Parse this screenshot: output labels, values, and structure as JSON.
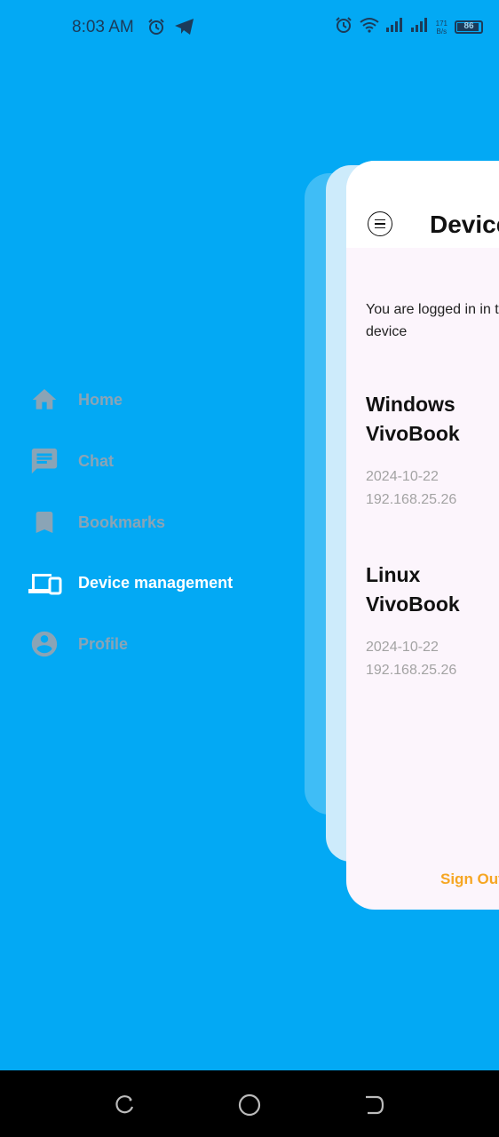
{
  "status_bar": {
    "time": "8:03 AM",
    "net_speed_value": "171",
    "net_speed_unit": "B/s",
    "battery_level": "86",
    "left_icons": [
      "alarm-icon",
      "telegram-icon"
    ],
    "right_icons": [
      "alarm-icon",
      "wifi-icon",
      "signal-icon",
      "signal-icon",
      "battery-icon"
    ]
  },
  "drawer": {
    "items": [
      {
        "label": "Home",
        "icon": "home-icon"
      },
      {
        "label": "Chat",
        "icon": "chat-icon"
      },
      {
        "label": "Bookmarks",
        "icon": "bookmark-icon"
      },
      {
        "label": "Device management",
        "icon": "devices-icon",
        "active": true
      },
      {
        "label": "Profile",
        "icon": "profile-icon"
      }
    ]
  },
  "screen": {
    "title": "Device",
    "intro": "You are logged in in these device",
    "devices": [
      {
        "name": "Windows VivoBook",
        "date": "2024-10-22",
        "ip": "192.168.25.26"
      },
      {
        "name": "Linux VivoBook",
        "date": "2024-10-22",
        "ip": "192.168.25.26"
      }
    ],
    "sign_out": "Sign Out"
  },
  "colors": {
    "background": "#03A9F4",
    "card": "#fcf5fc",
    "accent": "#F6A623",
    "inactive_menu": "#8aa4b6",
    "active_menu": "#ffffff"
  },
  "nav_bar": [
    "recent-apps-icon",
    "home-circle-icon",
    "back-icon"
  ]
}
